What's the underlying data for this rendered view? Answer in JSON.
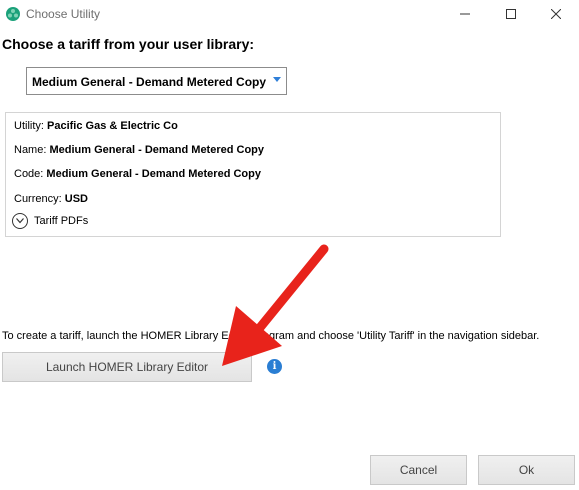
{
  "window": {
    "title": "Choose Utility",
    "accent_color": "#1ba17a"
  },
  "heading": "Choose a tariff from your user library:",
  "tariff_select": {
    "selected": "Medium General - Demand Metered Copy"
  },
  "details": {
    "utility_label": "Utility:",
    "utility_value": "Pacific Gas & Electric Co",
    "name_label": "Name:",
    "name_value": "Medium General - Demand Metered Copy",
    "code_label": "Code:",
    "code_value": "Medium General - Demand Metered Copy",
    "currency_label": "Currency:",
    "currency_value": "USD",
    "pdfs_label": "Tariff PDFs"
  },
  "hint_text": "To create a tariff, launch the HOMER Library Editor program and choose 'Utility Tariff' in the navigation sidebar.",
  "launch_button": "Launch HOMER Library Editor",
  "info_icon_glyph": "i",
  "footer": {
    "cancel": "Cancel",
    "ok": "Ok"
  },
  "annotation_arrow_color": "#e8231b"
}
